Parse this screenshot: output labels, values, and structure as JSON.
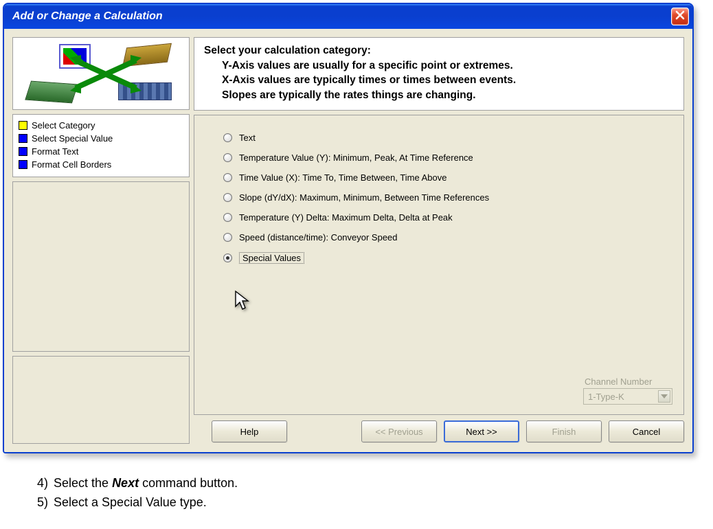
{
  "window": {
    "title": "Add or Change a Calculation"
  },
  "nav": {
    "items": [
      {
        "color": "yellow",
        "label": "Select Category"
      },
      {
        "color": "blue",
        "label": "Select Special Value"
      },
      {
        "color": "blue",
        "label": "Format Text"
      },
      {
        "color": "blue",
        "label": "Format Cell Borders"
      }
    ]
  },
  "heading": {
    "line0": "Select your calculation category:",
    "line1": "Y-Axis values are usually for a specific point or extremes.",
    "line2": "X-Axis values are typically times or times between events.",
    "line3": "Slopes are typically the rates things are changing."
  },
  "options": [
    {
      "label": "Text",
      "selected": false
    },
    {
      "label": "Temperature Value (Y):  Minimum, Peak, At Time Reference",
      "selected": false
    },
    {
      "label": "Time Value (X):  Time To, Time Between, Time Above",
      "selected": false
    },
    {
      "label": "Slope (dY/dX):  Maximum, Minimum, Between Time References",
      "selected": false
    },
    {
      "label": "Temperature (Y) Delta:  Maximum Delta, Delta at Peak",
      "selected": false
    },
    {
      "label": "Speed (distance/time): Conveyor Speed",
      "selected": false
    },
    {
      "label": "Special Values",
      "selected": true
    }
  ],
  "channel": {
    "label": "Channel Number",
    "value": "1-Type-K"
  },
  "buttons": {
    "help": "Help",
    "previous": "<< Previous",
    "next": "Next >>",
    "finish": "Finish",
    "cancel": "Cancel"
  },
  "instructions": {
    "step4_num": "4)",
    "step4_a": "Select the ",
    "step4_b": "Next",
    "step4_c": " command button.",
    "step5_num": "5)",
    "step5": "Select a Special Value type."
  }
}
